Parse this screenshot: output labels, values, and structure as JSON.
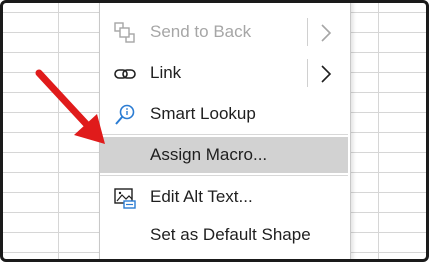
{
  "context_menu": {
    "items": [
      {
        "label": "Send to Back",
        "icon": "send-to-back-icon",
        "disabled": true,
        "has_submenu": true
      },
      {
        "label": "Link",
        "icon": "link-icon",
        "disabled": false,
        "has_submenu": true
      },
      {
        "label": "Smart Lookup",
        "icon": "smart-lookup-icon",
        "disabled": false,
        "has_submenu": false
      },
      {
        "label": "Assign Macro...",
        "icon": "",
        "disabled": false,
        "has_submenu": false,
        "highlighted": true
      },
      {
        "label": "Edit Alt Text...",
        "icon": "alt-text-icon",
        "disabled": false,
        "has_submenu": false
      },
      {
        "label": "Set as Default Shape",
        "icon": "",
        "disabled": false,
        "has_submenu": false
      }
    ]
  },
  "colors": {
    "highlight": "#d2d2d2",
    "arrow": "#e01b1b",
    "lookup_icon": "#2b7cd3"
  },
  "annotation": {
    "icon": "red-pointer-arrow"
  }
}
